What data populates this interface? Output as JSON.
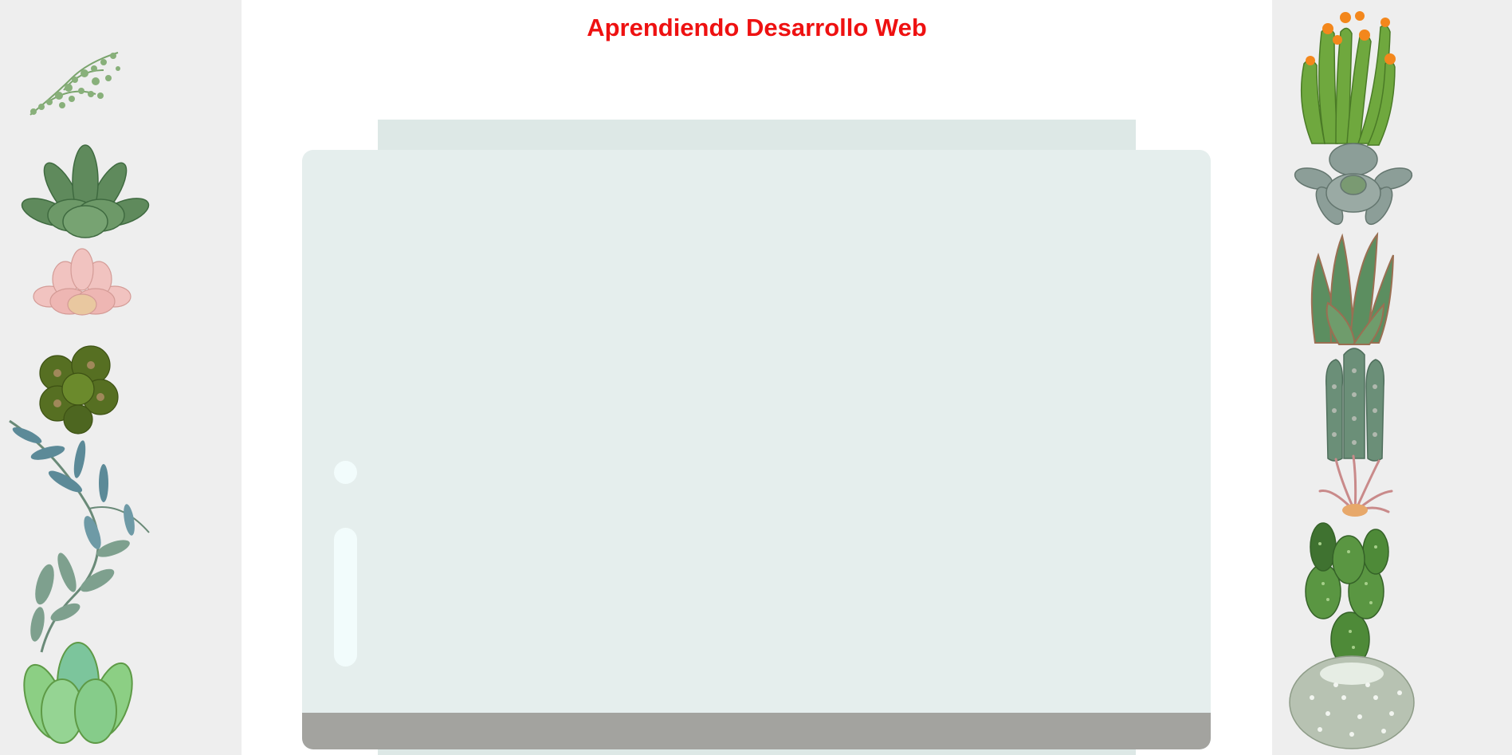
{
  "title": "Aprendiendo Desarrollo Web",
  "colors": {
    "title": "#ee1111",
    "side_background": "#eeeeee",
    "jar_glass": "#e5eeed",
    "jar_lid": "#dde8e6",
    "jar_soil": "#a3a39f",
    "glare": "#f2fcfc"
  },
  "left_plants": [
    "string-of-pearls-plant",
    "green-succulent-plant",
    "pink-succulent-plant",
    "dark-green-succulent-plant",
    "eucalyptus-branch-plant",
    "light-green-succulent-plant"
  ],
  "right_plants": [
    "flowering-cactus-plant",
    "gray-succulent-plant",
    "aloe-plant",
    "columnar-cactus-plant",
    "air-plant",
    "prickly-pear-cactus-plant",
    "round-white-cactus-plant"
  ]
}
